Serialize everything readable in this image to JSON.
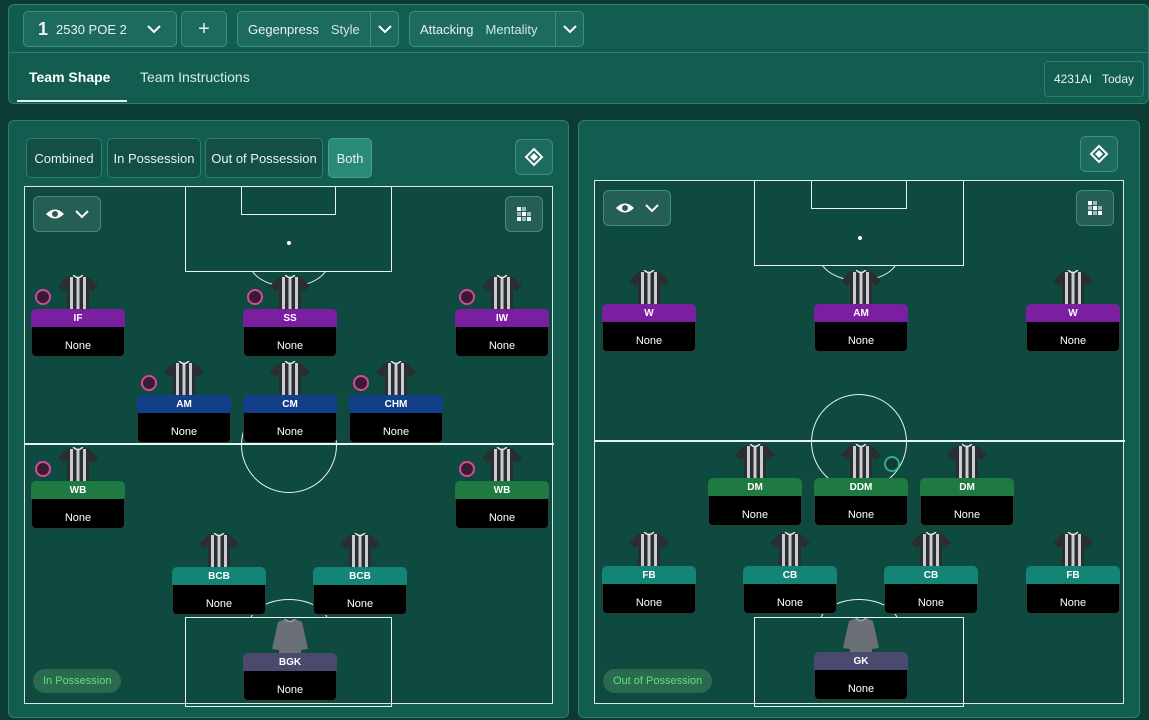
{
  "header": {
    "tactic_slot": "1",
    "tactic_name": "2530 POE 2",
    "add_label": "+",
    "style_value": "Gegenpress",
    "style_label": "Style",
    "mentality_value": "Attacking",
    "mentality_label": "Mentality",
    "tabs": [
      {
        "label": "Team Shape"
      },
      {
        "label": "Team Instructions"
      }
    ],
    "saved_name": "4231AI",
    "saved_date": "Today"
  },
  "left_panel": {
    "filters": [
      {
        "label": "Combined"
      },
      {
        "label": "In Possession"
      },
      {
        "label": "Out of Possession"
      },
      {
        "label": "Both"
      }
    ],
    "phase_pill": "In Possession",
    "players": [
      {
        "role": "IF",
        "duty": "None"
      },
      {
        "role": "SS",
        "duty": "None"
      },
      {
        "role": "IW",
        "duty": "None"
      },
      {
        "role": "AM",
        "duty": "None"
      },
      {
        "role": "CM",
        "duty": "None"
      },
      {
        "role": "CHM",
        "duty": "None"
      },
      {
        "role": "WB",
        "duty": "None"
      },
      {
        "role": "WB",
        "duty": "None"
      },
      {
        "role": "BCB",
        "duty": "None"
      },
      {
        "role": "BCB",
        "duty": "None"
      },
      {
        "role": "BGK",
        "duty": "None"
      }
    ]
  },
  "right_panel": {
    "phase_pill": "Out of Possession",
    "players": [
      {
        "role": "W",
        "duty": "None"
      },
      {
        "role": "AM",
        "duty": "None"
      },
      {
        "role": "W",
        "duty": "None"
      },
      {
        "role": "DM",
        "duty": "None"
      },
      {
        "role": "DDM",
        "duty": "None"
      },
      {
        "role": "DM",
        "duty": "None"
      },
      {
        "role": "FB",
        "duty": "None"
      },
      {
        "role": "CB",
        "duty": "None"
      },
      {
        "role": "CB",
        "duty": "None"
      },
      {
        "role": "FB",
        "duty": "None"
      },
      {
        "role": "GK",
        "duty": "None"
      }
    ]
  },
  "colors": {
    "attack_role": "#7a1fa0",
    "mid_role": "#123f8a",
    "wingback_role": "#1f7a42",
    "defence_role": "#138475",
    "keeper_role": "#4a4a6e"
  },
  "icons": [
    "chevron-down-icon",
    "plus-icon",
    "eye-icon",
    "grid-icon",
    "diamond-icon",
    "kit-icon",
    "instruction-badge-icon"
  ]
}
